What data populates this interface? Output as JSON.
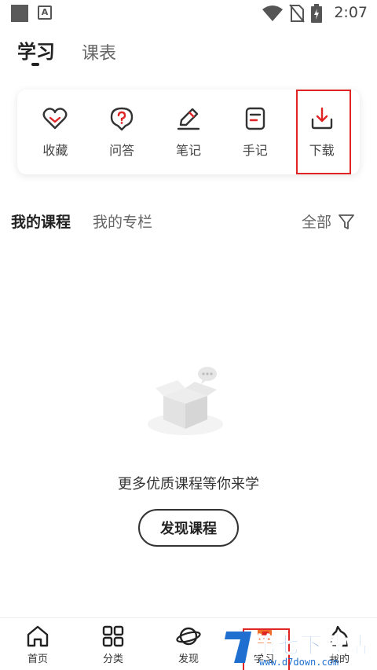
{
  "status_bar": {
    "time": "2:07",
    "icons": [
      "app-square-icon",
      "a-badge-icon",
      "wifi-icon",
      "no-sim-icon",
      "battery-charging-icon"
    ]
  },
  "top_tabs": [
    {
      "label": "学习",
      "active": true
    },
    {
      "label": "课表",
      "active": false
    }
  ],
  "tools": [
    {
      "label": "收藏",
      "icon": "heart-icon"
    },
    {
      "label": "问答",
      "icon": "question-bubble-icon"
    },
    {
      "label": "笔记",
      "icon": "pen-icon"
    },
    {
      "label": "手记",
      "icon": "note-icon"
    },
    {
      "label": "下载",
      "icon": "download-icon"
    }
  ],
  "section_tabs": [
    {
      "label": "我的课程",
      "active": true
    },
    {
      "label": "我的专栏",
      "active": false
    }
  ],
  "filter": {
    "label": "全部",
    "icon": "filter-icon"
  },
  "empty_state": {
    "message": "更多优质课程等你来学",
    "button": "发现课程",
    "icon": "empty-box-icon"
  },
  "bottom_nav": [
    {
      "label": "首页",
      "icon": "home-icon"
    },
    {
      "label": "分类",
      "icon": "grid-icon"
    },
    {
      "label": "发现",
      "icon": "planet-icon"
    },
    {
      "label": "学习",
      "icon": "study-icon",
      "active": true
    },
    {
      "label": "我的",
      "icon": "profile-icon"
    }
  ],
  "watermark": {
    "title": "第七下载站",
    "url": "www.d7down.com"
  },
  "colors": {
    "highlight": "#e02424",
    "text_primary": "#222222",
    "watermark_blue": "#1e6fd0"
  }
}
